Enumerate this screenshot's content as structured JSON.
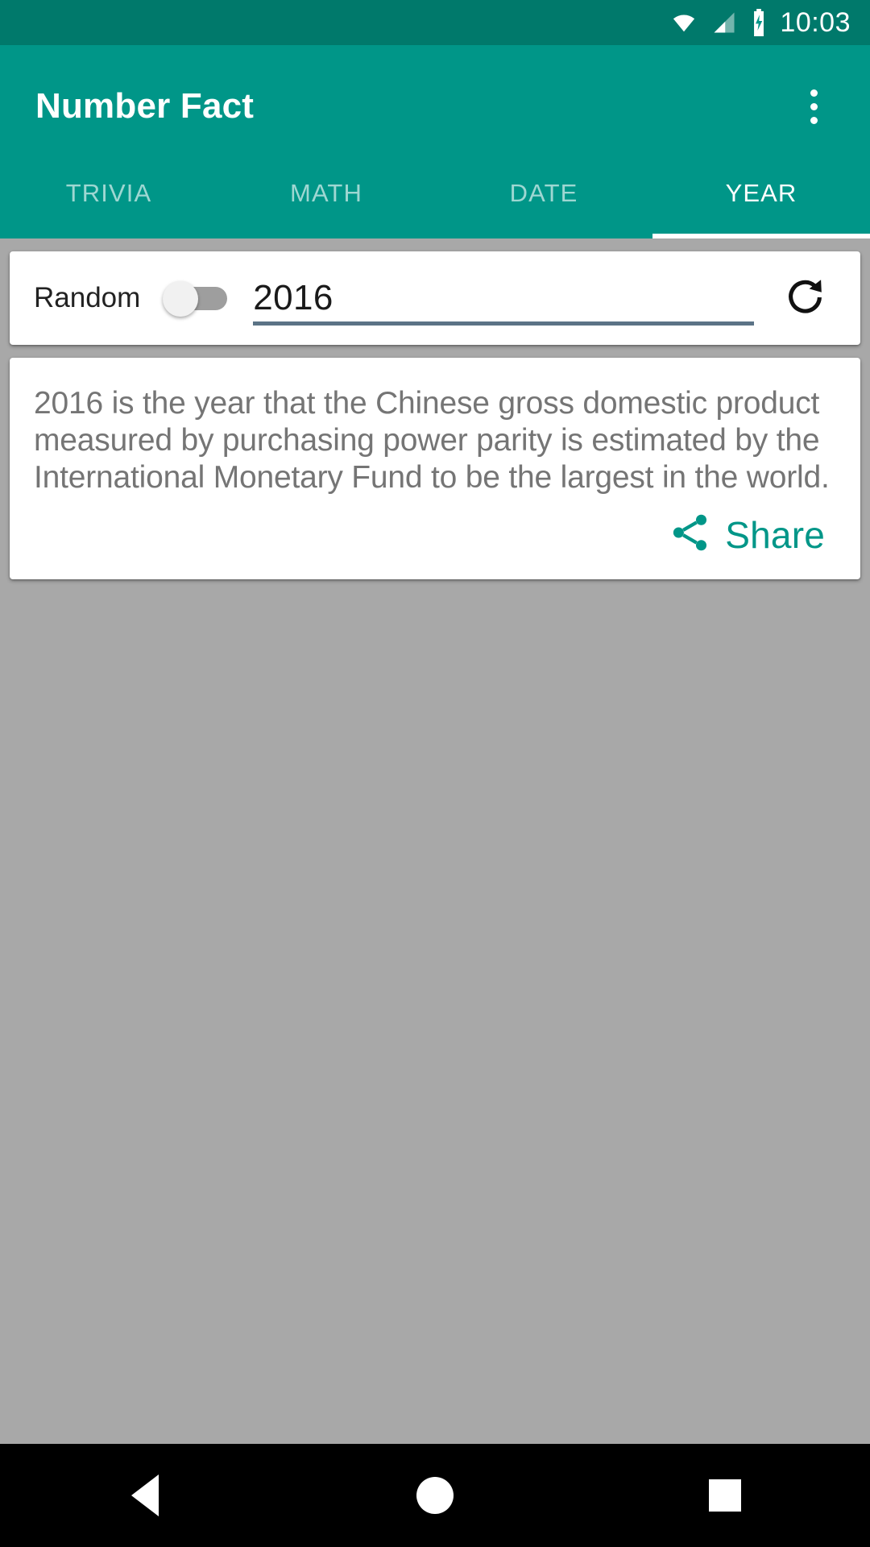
{
  "statusbar": {
    "time": "10:03",
    "icons": [
      "wifi-icon",
      "cellular-signal-icon",
      "battery-charging-icon"
    ]
  },
  "appbar": {
    "title": "Number Fact",
    "overflow_menu": "overflow-menu-icon"
  },
  "tabs": [
    {
      "label": "TRIVIA",
      "active": false
    },
    {
      "label": "MATH",
      "active": false
    },
    {
      "label": "DATE",
      "active": false
    },
    {
      "label": "YEAR",
      "active": true
    }
  ],
  "input_card": {
    "random_label": "Random",
    "random_toggle_state": "off",
    "number_value": "2016",
    "number_placeholder": "2016",
    "refresh_icon": "refresh-icon"
  },
  "fact_card": {
    "text": "2016 is the year that the Chinese gross domestic product measured by purchasing power parity is estimated by the International Monetary Fund to be the largest in the world.",
    "share_label": "Share",
    "share_icon": "share-icon"
  },
  "navbar": {
    "back": "back-icon",
    "home": "home-icon",
    "recents": "recents-icon"
  },
  "colors": {
    "status_bar": "#00796b",
    "app_bar": "#009688",
    "accent": "#009688",
    "background": "#a8a8a8",
    "card": "#ffffff",
    "fact_text": "#757575",
    "input_underline": "#5b7386",
    "nav_bar": "#000000"
  }
}
